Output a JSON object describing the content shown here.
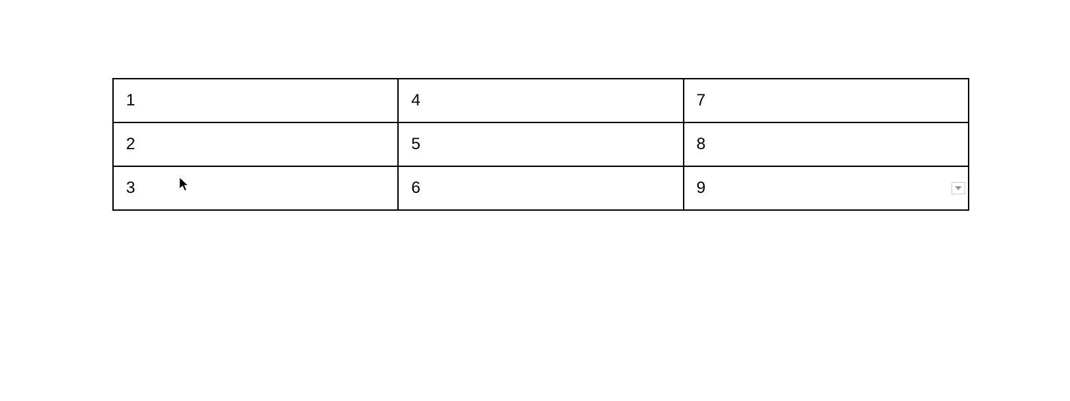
{
  "table": {
    "rows": [
      {
        "cells": [
          "1",
          "4",
          "7"
        ]
      },
      {
        "cells": [
          "2",
          "5",
          "8"
        ]
      },
      {
        "cells": [
          "3",
          "6",
          "9"
        ]
      }
    ]
  }
}
